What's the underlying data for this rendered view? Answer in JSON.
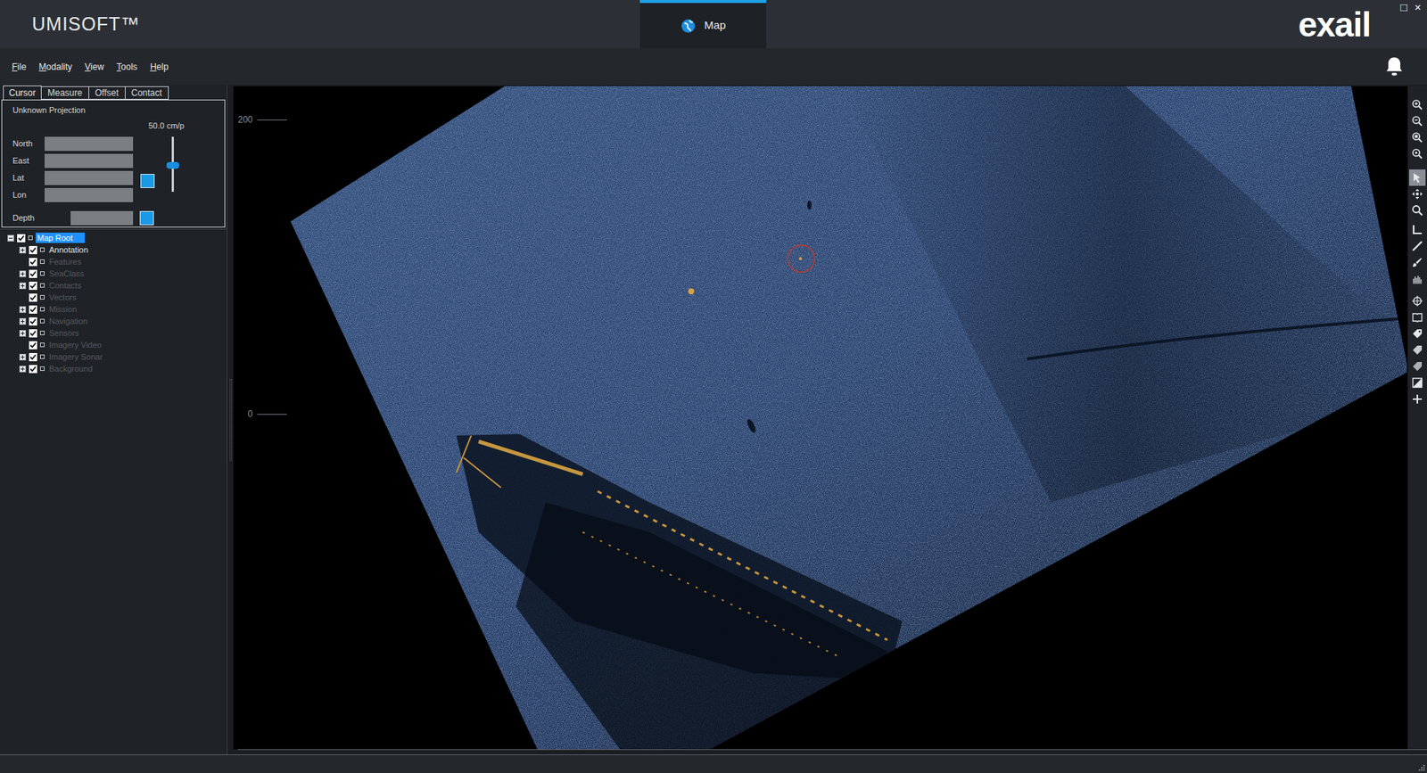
{
  "window": {
    "title": "UMISOFT™",
    "logo": "exail",
    "controls": [
      "□",
      "×"
    ]
  },
  "app_tabs": [
    {
      "label": "Map",
      "selected": true
    }
  ],
  "menu": [
    {
      "label": "File",
      "underlined_first": true
    },
    {
      "label": "Modality",
      "underlined_first": true
    },
    {
      "label": "View",
      "underlined_first": true
    },
    {
      "label": "Tools",
      "underlined_first": true
    },
    {
      "label": "Help",
      "underlined_first": true
    }
  ],
  "left_panel": {
    "tabs": [
      {
        "label": "Cursor",
        "selected": true
      },
      {
        "label": "Measure",
        "selected": false
      },
      {
        "label": "Offset",
        "selected": false
      },
      {
        "label": "Contact",
        "selected": false
      }
    ],
    "cursor": {
      "projection": "Unknown Projection",
      "resolution": "50.0 cm/p",
      "resolution_slider": {
        "level": 0.48
      },
      "fields": [
        {
          "label": "North",
          "value": ""
        },
        {
          "label": "East",
          "value": ""
        },
        {
          "label": "Lat",
          "value": ""
        },
        {
          "label": "Lon",
          "value": ""
        }
      ],
      "depth": {
        "label": "Depth",
        "value": ""
      }
    }
  },
  "layer_tree": [
    {
      "label": "Map Root",
      "depth": 0,
      "expandable": true,
      "expanded": true,
      "checked": true,
      "selected": true,
      "greyed": false
    },
    {
      "label": "Annotation",
      "depth": 1,
      "expandable": true,
      "expanded": false,
      "checked": true,
      "selected": false,
      "greyed": false
    },
    {
      "label": "Features",
      "depth": 1,
      "expandable": false,
      "expanded": false,
      "checked": true,
      "selected": false,
      "greyed": true
    },
    {
      "label": "SeaClass",
      "depth": 1,
      "expandable": true,
      "expanded": false,
      "checked": true,
      "selected": false,
      "greyed": true
    },
    {
      "label": "Contacts",
      "depth": 1,
      "expandable": true,
      "expanded": false,
      "checked": true,
      "selected": false,
      "greyed": true
    },
    {
      "label": "Vectors",
      "depth": 1,
      "expandable": false,
      "expanded": false,
      "checked": true,
      "selected": false,
      "greyed": true
    },
    {
      "label": "Mission",
      "depth": 1,
      "expandable": true,
      "expanded": false,
      "checked": true,
      "selected": false,
      "greyed": true
    },
    {
      "label": "Navigation",
      "depth": 1,
      "expandable": true,
      "expanded": false,
      "checked": true,
      "selected": false,
      "greyed": true
    },
    {
      "label": "Sensors",
      "depth": 1,
      "expandable": true,
      "expanded": false,
      "checked": true,
      "selected": false,
      "greyed": true
    },
    {
      "label": "Imagery Video",
      "depth": 1,
      "expandable": false,
      "expanded": false,
      "checked": true,
      "selected": false,
      "greyed": true
    },
    {
      "label": "Imagery Sonar",
      "depth": 1,
      "expandable": true,
      "expanded": false,
      "checked": true,
      "selected": false,
      "greyed": true
    },
    {
      "label": "Background",
      "depth": 1,
      "expandable": true,
      "expanded": false,
      "checked": true,
      "selected": false,
      "greyed": true
    }
  ],
  "map": {
    "scale_labels": [
      "200",
      "0"
    ]
  },
  "toolbar": {
    "tools": [
      {
        "selected": false
      },
      {
        "selected": false
      },
      {
        "selected": false
      },
      {
        "selected": false
      },
      {
        "selected": true
      },
      {
        "selected": false
      },
      {
        "selected": false
      },
      {
        "selected": false
      },
      {
        "selected": false
      },
      {
        "selected": false
      },
      {
        "selected": false
      },
      {
        "selected": false
      },
      {
        "selected": false
      },
      {
        "selected": false
      },
      {
        "selected": false
      },
      {
        "selected": false
      },
      {
        "selected": false
      },
      {
        "selected": false
      }
    ]
  }
}
